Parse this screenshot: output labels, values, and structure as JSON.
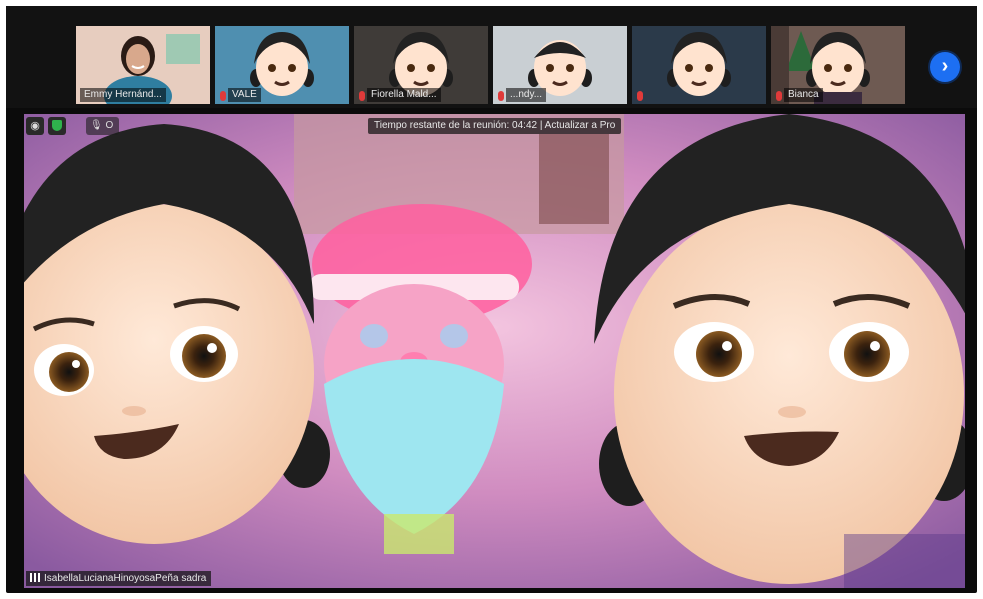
{
  "gallery": {
    "participants": [
      {
        "name": "Emmy Hernánd...",
        "muted": false,
        "kind": "video-person",
        "bg": "#d9b7a4"
      },
      {
        "name": "VALE",
        "muted": true,
        "kind": "memoji",
        "bg": "#4f8fb0"
      },
      {
        "name": "Fiorella Mald...",
        "muted": true,
        "kind": "memoji",
        "bg": "#3f3b38"
      },
      {
        "name": "...ndy...",
        "muted": true,
        "kind": "memoji-boy",
        "bg": "#c9cfd3"
      },
      {
        "name": "",
        "muted": true,
        "kind": "memoji",
        "bg": "#2b3a4a"
      },
      {
        "name": "Bianca",
        "muted": true,
        "kind": "memoji-tree",
        "bg": "#6e5a52"
      }
    ],
    "next_label": "›"
  },
  "main_video": {
    "timer_text": "Tiempo restante de la reunión: 04:42 | Actualizar a Pro",
    "speaker_name": "IsabellaLucianaHinoyosaPeña sadra",
    "rec_text": "O"
  },
  "colors": {
    "accent": "#1d6ff2",
    "muted_mic": "#e03a3a",
    "shield": "#2fb34d"
  },
  "icons": {
    "next": "chevron-right-icon",
    "info": "info-icon",
    "shield": "shield-icon",
    "mic": "mic-muted-icon"
  }
}
